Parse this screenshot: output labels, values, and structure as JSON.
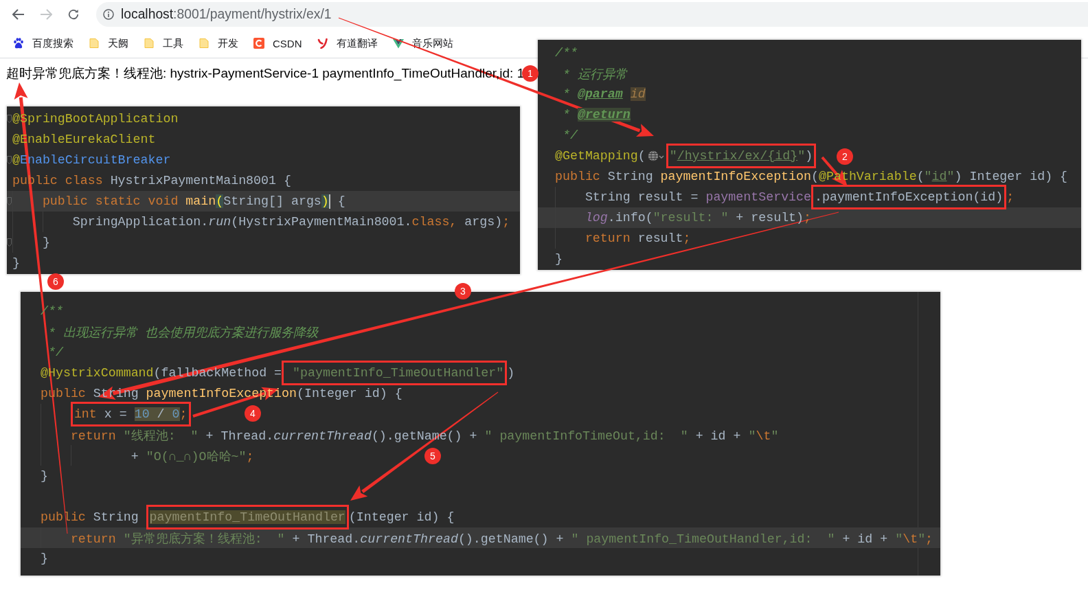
{
  "browser": {
    "nav_buttons": [
      {
        "kind": "back",
        "disabled": false
      },
      {
        "kind": "forward",
        "disabled": true
      },
      {
        "kind": "reload",
        "disabled": false
      }
    ],
    "address_bar": {
      "host": "localhost",
      "path": ":8001/payment/hystrix/ex/1"
    },
    "bookmarks": [
      {
        "kind": "paw",
        "label": "百度搜索"
      },
      {
        "kind": "folder",
        "label": "天阙"
      },
      {
        "kind": "folder",
        "label": "工具"
      },
      {
        "kind": "folder",
        "label": "开发"
      },
      {
        "kind": "letter",
        "label": "CSDN"
      },
      {
        "kind": "script",
        "label": "有道翻译"
      },
      {
        "kind": "chevron",
        "label": "音乐网站"
      }
    ]
  },
  "page": {
    "response_text": "超时异常兜底方案！线程池: hystrix-PaymentService-1 paymentInfo_TimeOutHandler,id: 1"
  },
  "code_panels": [
    {
      "lines": [
        {
          "current": false,
          "parts": [
            {
              "kind": "fold"
            },
            {
              "kind": "code",
              "runs": [
                {
                  "kind": "annotation",
                  "text": "@SpringBootApplication"
                }
              ]
            }
          ]
        },
        {
          "current": false,
          "parts": [
            {
              "kind": "code",
              "runs": [
                {
                  "kind": "annotation",
                  "text": "@EnableEurekaClient"
                }
              ]
            }
          ]
        },
        {
          "current": false,
          "parts": [
            {
              "kind": "fold"
            },
            {
              "kind": "code",
              "runs": [
                {
                  "kind": "annotation",
                  "text": "@"
                },
                {
                  "kind": "reference",
                  "text": "EnableCircuitBreaker"
                }
              ]
            }
          ]
        },
        {
          "current": false,
          "parts": [
            {
              "kind": "code",
              "runs": [
                {
                  "kind": "keyword",
                  "text": "public class"
                },
                {
                  "kind": "plain",
                  "text": " HystrixPaymentMain8001 {"
                }
              ]
            }
          ],
          "children": [
            {
              "current": true,
              "parts": [
                {
                  "kind": "fold"
                },
                {
                  "kind": "code",
                  "runs": [
                    {
                      "kind": "keyword",
                      "text": "public static void "
                    },
                    {
                      "kind": "method",
                      "text": "main"
                    },
                    {
                      "kind": "brace",
                      "text": "("
                    },
                    {
                      "kind": "plain",
                      "text": "String[] args"
                    },
                    {
                      "kind": "brace",
                      "text": ")"
                    }
                  ]
                },
                {
                  "kind": "caret"
                },
                {
                  "kind": "code",
                  "runs": [
                    {
                      "kind": "plain",
                      "text": " {"
                    }
                  ]
                }
              ],
              "children": [
                {
                  "current": false,
                  "parts": [
                    {
                      "kind": "code",
                      "runs": [
                        {
                          "kind": "plain",
                          "text": "SpringApplication."
                        },
                        {
                          "kind": "static",
                          "text": "run"
                        },
                        {
                          "kind": "plain",
                          "text": "(HystrixPaymentMain8001."
                        },
                        {
                          "kind": "keyword",
                          "text": "class, "
                        },
                        {
                          "kind": "plain",
                          "text": "args)"
                        },
                        {
                          "kind": "keyword",
                          "text": ";"
                        }
                      ]
                    }
                  ]
                }
              ]
            },
            {
              "current": false,
              "parts": [
                {
                  "kind": "fold"
                },
                {
                  "kind": "code",
                  "runs": [
                    {
                      "kind": "plain",
                      "text": "}"
                    }
                  ]
                }
              ]
            }
          ]
        },
        {
          "current": false,
          "parts": [
            {
              "kind": "code",
              "runs": [
                {
                  "kind": "plain",
                  "text": "}"
                }
              ]
            }
          ]
        }
      ]
    },
    {
      "lines": [
        {
          "current": false,
          "parts": [
            {
              "kind": "code",
              "runs": [
                {
                  "kind": "javadoc",
                  "text": "/**"
                }
              ]
            }
          ]
        },
        {
          "current": false,
          "parts": [
            {
              "kind": "code",
              "runs": [
                {
                  "kind": "javadoc",
                  "text": " * 运行异常"
                }
              ]
            }
          ]
        },
        {
          "current": false,
          "parts": [
            {
              "kind": "code",
              "runs": [
                {
                  "kind": "javadoc",
                  "text": " * "
                },
                {
                  "kind": "doctag",
                  "text": "@param"
                },
                {
                  "kind": "docref",
                  "text": " id"
                }
              ]
            }
          ]
        },
        {
          "current": false,
          "parts": [
            {
              "kind": "code",
              "runs": [
                {
                  "kind": "javadoc",
                  "text": " * "
                },
                {
                  "kind": "hldoctag",
                  "text": "@return"
                }
              ]
            }
          ]
        },
        {
          "current": false,
          "parts": [
            {
              "kind": "code",
              "runs": [
                {
                  "kind": "javadoc",
                  "text": " */"
                }
              ]
            }
          ]
        },
        {
          "current": false,
          "parts": [
            {
              "kind": "code",
              "runs": [
                {
                  "kind": "annotation",
                  "text": "@GetMapping"
                },
                {
                  "kind": "plain",
                  "text": "("
                }
              ]
            },
            {
              "kind": "globe"
            },
            {
              "kind": "frame",
              "runs": [
                {
                  "kind": "string",
                  "text": "\""
                },
                {
                  "kind": "link",
                  "text": "/hystrix/ex/{id}"
                },
                {
                  "kind": "string",
                  "text": "\""
                },
                {
                  "kind": "plain",
                  "text": ")"
                }
              ]
            }
          ]
        },
        {
          "current": false,
          "parts": [
            {
              "kind": "code",
              "runs": [
                {
                  "kind": "keyword",
                  "text": "public"
                },
                {
                  "kind": "plain",
                  "text": " String "
                },
                {
                  "kind": "method",
                  "text": "paymentInfoException"
                },
                {
                  "kind": "plain",
                  "text": "("
                },
                {
                  "kind": "annotation",
                  "text": "@PathVariable"
                },
                {
                  "kind": "plain",
                  "text": "("
                },
                {
                  "kind": "string",
                  "text": "\""
                },
                {
                  "kind": "link",
                  "text": "id"
                },
                {
                  "kind": "string",
                  "text": "\""
                },
                {
                  "kind": "plain",
                  "text": ") Integer id) {"
                }
              ]
            }
          ],
          "children": [
            {
              "current": false,
              "parts": [
                {
                  "kind": "code",
                  "runs": [
                    {
                      "kind": "plain",
                      "text": "String result = "
                    },
                    {
                      "kind": "field",
                      "text": "paymentService"
                    }
                  ]
                },
                {
                  "kind": "frame",
                  "runs": [
                    {
                      "kind": "plain",
                      "text": ".paymentInfoException(id)"
                    }
                  ]
                },
                {
                  "kind": "code",
                  "runs": [
                    {
                      "kind": "keyword",
                      "text": ";"
                    }
                  ]
                }
              ]
            },
            {
              "current": true,
              "parts": [
                {
                  "kind": "code",
                  "runs": [
                    {
                      "kind": "staticfield",
                      "text": "log"
                    },
                    {
                      "kind": "plain",
                      "text": ".info("
                    },
                    {
                      "kind": "string",
                      "text": "\"result: \""
                    },
                    {
                      "kind": "plain",
                      "text": " + result)"
                    },
                    {
                      "kind": "keyword",
                      "text": ";"
                    }
                  ]
                }
              ]
            },
            {
              "current": false,
              "parts": [
                {
                  "kind": "code",
                  "runs": [
                    {
                      "kind": "keyword",
                      "text": "return"
                    },
                    {
                      "kind": "plain",
                      "text": " result"
                    },
                    {
                      "kind": "keyword",
                      "text": ";"
                    }
                  ]
                }
              ]
            }
          ]
        },
        {
          "current": false,
          "parts": [
            {
              "kind": "code",
              "runs": [
                {
                  "kind": "plain",
                  "text": "}"
                }
              ]
            }
          ]
        }
      ]
    },
    {
      "lines": [
        {
          "current": false,
          "parts": [
            {
              "kind": "code",
              "runs": [
                {
                  "kind": "javadoc",
                  "text": "/**"
                }
              ]
            }
          ]
        },
        {
          "current": false,
          "parts": [
            {
              "kind": "code",
              "runs": [
                {
                  "kind": "javadoc",
                  "text": " * 出现运行异常 也会使用兜底方案进行服务降级"
                }
              ]
            }
          ]
        },
        {
          "current": false,
          "parts": [
            {
              "kind": "code",
              "runs": [
                {
                  "kind": "javadoc",
                  "text": " */"
                }
              ]
            }
          ]
        },
        {
          "current": false,
          "parts": [
            {
              "kind": "code",
              "runs": [
                {
                  "kind": "annotation",
                  "text": "@HystrixCommand"
                },
                {
                  "kind": "plain",
                  "text": "(fallbackMethod ="
                }
              ]
            },
            {
              "kind": "frame",
              "runs": [
                {
                  "kind": "string",
                  "text": " \"paymentInfo_TimeOutHandler\""
                }
              ]
            },
            {
              "kind": "code",
              "runs": [
                {
                  "kind": "plain",
                  "text": ")"
                }
              ]
            }
          ]
        },
        {
          "current": false,
          "parts": [
            {
              "kind": "code",
              "runs": [
                {
                  "kind": "keyword",
                  "text": "public"
                },
                {
                  "kind": "plain",
                  "text": " String "
                },
                {
                  "kind": "method",
                  "text": "paymentInfoException"
                },
                {
                  "kind": "plain",
                  "text": "(Integer id) {"
                }
              ]
            }
          ],
          "children": [
            {
              "current": false,
              "parts": [
                {
                  "kind": "frame",
                  "runs": [
                    {
                      "kind": "keyword",
                      "text": "int"
                    },
                    {
                      "kind": "plain",
                      "text": " x = "
                    },
                    {
                      "kind": "hlnumber",
                      "text": "10"
                    },
                    {
                      "kind": "hlplain",
                      "text": " / "
                    },
                    {
                      "kind": "hlnumber",
                      "text": "0"
                    },
                    {
                      "kind": "keyword",
                      "text": ";"
                    }
                  ]
                }
              ]
            },
            {
              "current": false,
              "parts": [
                {
                  "kind": "code",
                  "runs": [
                    {
                      "kind": "keyword",
                      "text": "return "
                    },
                    {
                      "kind": "string",
                      "text": "\"线程池:  \""
                    },
                    {
                      "kind": "plain",
                      "text": " + Thread."
                    },
                    {
                      "kind": "static",
                      "text": "currentThread"
                    },
                    {
                      "kind": "plain",
                      "text": "().getName() + "
                    },
                    {
                      "kind": "string",
                      "text": "\" paymentInfoTimeOut,id:  \""
                    },
                    {
                      "kind": "plain",
                      "text": " + id + "
                    },
                    {
                      "kind": "string",
                      "text": "\""
                    },
                    {
                      "kind": "escape",
                      "text": "\\t"
                    },
                    {
                      "kind": "string",
                      "text": "\""
                    }
                  ]
                }
              ],
              "children": [
                {
                  "kind": "continuation",
                  "current": false,
                  "parts": [
                    {
                      "kind": "code",
                      "runs": [
                        {
                          "kind": "plain",
                          "text": "+ "
                        },
                        {
                          "kind": "string",
                          "text": "\"O(∩_∩)O哈哈~\""
                        },
                        {
                          "kind": "keyword",
                          "text": ";"
                        }
                      ]
                    }
                  ]
                }
              ]
            }
          ]
        },
        {
          "current": false,
          "parts": [
            {
              "kind": "code",
              "runs": [
                {
                  "kind": "plain",
                  "text": "}"
                }
              ]
            }
          ]
        },
        {
          "current": false
        },
        {
          "current": false,
          "parts": [
            {
              "kind": "code",
              "runs": [
                {
                  "kind": "keyword",
                  "text": "public"
                },
                {
                  "kind": "plain",
                  "text": " String "
                }
              ]
            },
            {
              "kind": "frame",
              "runs": [
                {
                  "kind": "hlmethod",
                  "text": "paymentInfo_TimeOutHandler"
                }
              ]
            },
            {
              "kind": "code",
              "runs": [
                {
                  "kind": "plain",
                  "text": "(Integer id) {"
                }
              ]
            }
          ],
          "children": [
            {
              "current": true,
              "parts": [
                {
                  "kind": "code",
                  "runs": [
                    {
                      "kind": "keyword",
                      "text": "return "
                    },
                    {
                      "kind": "string",
                      "text": "\"异常兜底方案！线程池:  \""
                    },
                    {
                      "kind": "plain",
                      "text": " + Thread."
                    },
                    {
                      "kind": "static",
                      "text": "currentThread"
                    },
                    {
                      "kind": "plain",
                      "text": "().getName() + "
                    },
                    {
                      "kind": "string",
                      "text": "\" paymentInfo_TimeOutHandler,id:  \""
                    },
                    {
                      "kind": "plain",
                      "text": " + id + "
                    },
                    {
                      "kind": "string",
                      "text": "\""
                    },
                    {
                      "kind": "escape",
                      "text": "\\t"
                    },
                    {
                      "kind": "string",
                      "text": "\""
                    },
                    {
                      "kind": "keyword",
                      "text": ";"
                    }
                  ]
                }
              ]
            }
          ]
        },
        {
          "current": false,
          "parts": [
            {
              "kind": "code",
              "runs": [
                {
                  "kind": "plain",
                  "text": "}"
                }
              ]
            }
          ]
        }
      ]
    }
  ],
  "step_badges": [
    {
      "label": "1"
    },
    {
      "label": "2"
    },
    {
      "label": "3"
    },
    {
      "label": "4"
    },
    {
      "label": "5"
    },
    {
      "label": "6"
    }
  ]
}
